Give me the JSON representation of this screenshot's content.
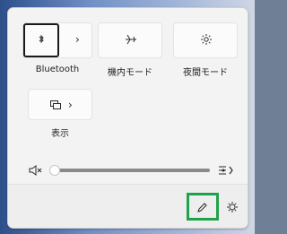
{
  "quick_settings": {
    "tiles": {
      "bluetooth": {
        "label": "Bluetooth",
        "icon": "bluetooth-icon",
        "chevron": "›"
      },
      "airplane": {
        "label": "機内モード",
        "icon": "airplane-icon"
      },
      "night_mode": {
        "label": "夜間モード",
        "icon": "night-mode-icon"
      },
      "display": {
        "label": "表示",
        "icon": "display-icon",
        "chevron": "›"
      }
    },
    "volume": {
      "muted_icon": "speaker-mute-icon",
      "level_percent": 0,
      "output_icon": "audio-output-icon"
    },
    "footer": {
      "edit_icon": "pencil-icon",
      "settings_icon": "gear-icon",
      "highlight_color": "#1fa34a"
    }
  }
}
